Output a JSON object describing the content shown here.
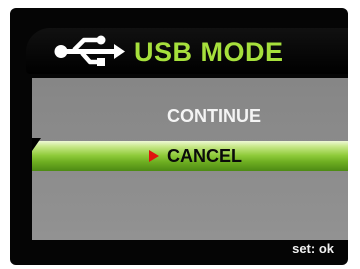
{
  "header": {
    "title": "USB MODE",
    "icon": "usb-icon",
    "title_color": "#a6e03c"
  },
  "menu": {
    "items": [
      {
        "label": "CONTINUE",
        "selected": false
      },
      {
        "label": "CANCEL",
        "selected": true
      }
    ],
    "highlight_color": "#8fcb3a",
    "cursor_icon": "triangle-right-icon",
    "cursor_color": "#e0140f"
  },
  "footer": {
    "hint": "set: ok"
  }
}
